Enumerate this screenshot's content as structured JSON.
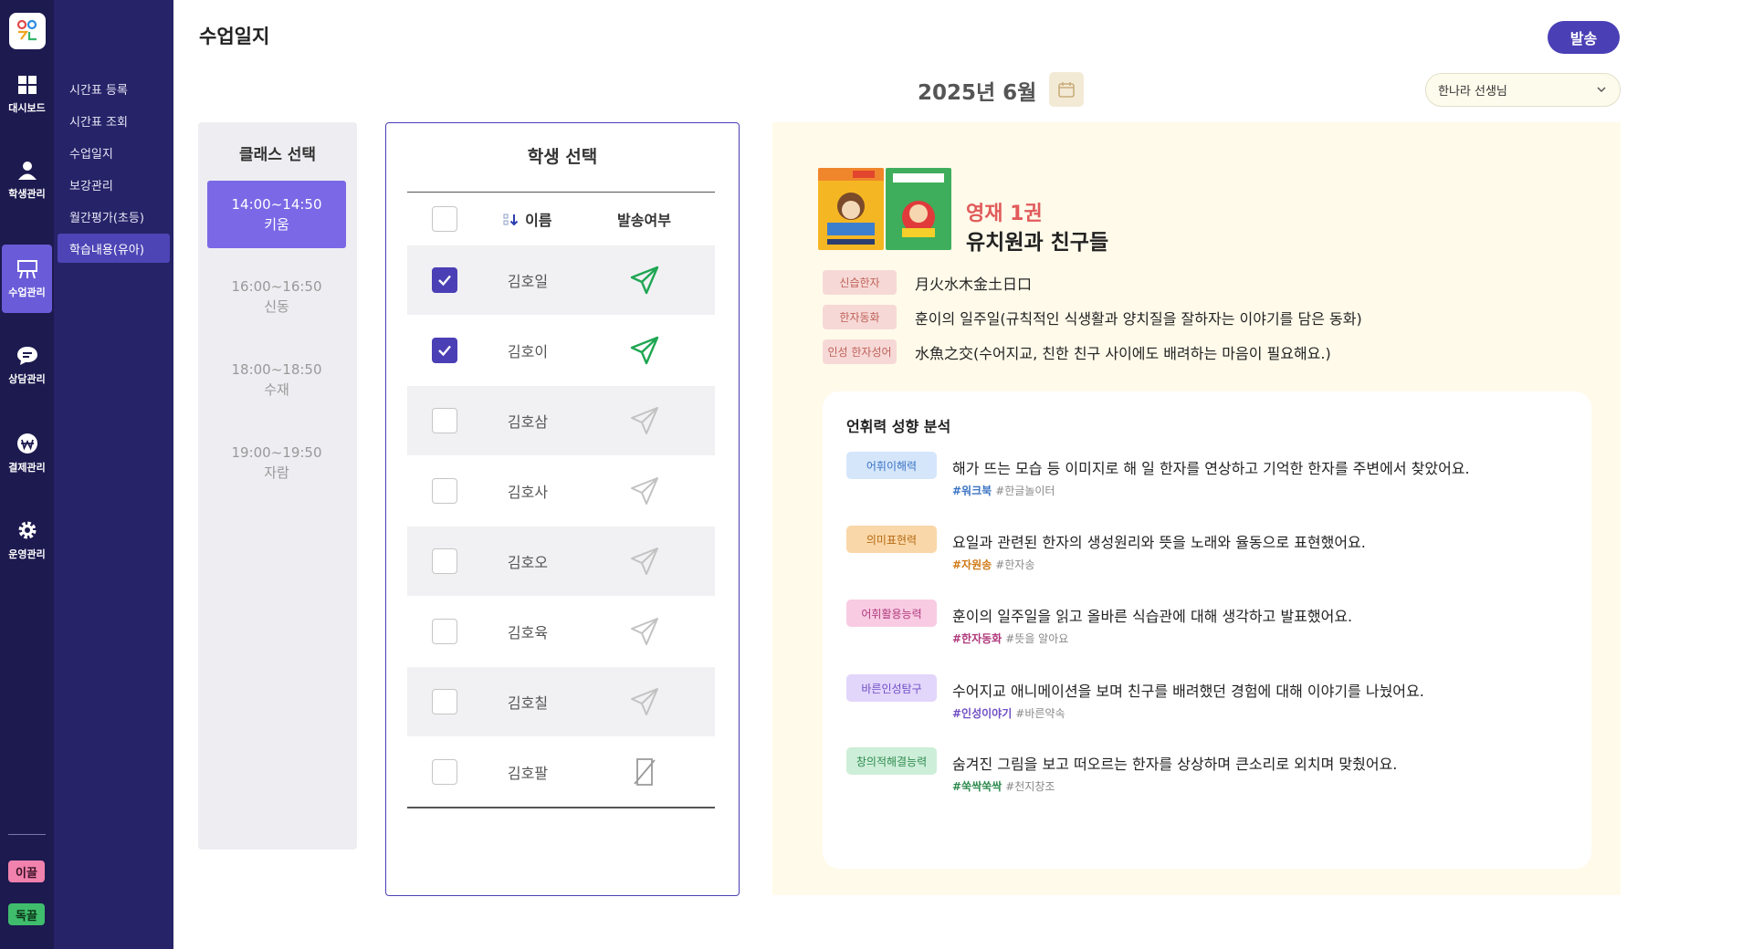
{
  "sidebar": {
    "items": [
      {
        "label": "대시보드",
        "icon": "dashboard-grid-icon"
      },
      {
        "label": "학생관리",
        "icon": "student-icon"
      },
      {
        "label": "수업관리",
        "icon": "classroom-easel-icon"
      },
      {
        "label": "상담관리",
        "icon": "chat-bubble-icon"
      },
      {
        "label": "결제관리",
        "icon": "won-coin-icon"
      },
      {
        "label": "운영관리",
        "icon": "gear-icon"
      }
    ],
    "badges": {
      "igeul": "이끌",
      "dokgeul": "독끌"
    },
    "colors": {
      "rail": "#1c1a4f",
      "active": "#6a5cd9"
    }
  },
  "submenu": {
    "items": [
      {
        "label": "시간표 등록"
      },
      {
        "label": "시간표 조회"
      },
      {
        "label": "수업일지"
      },
      {
        "label": "보강관리"
      },
      {
        "label": "월간평가(초등)"
      },
      {
        "label": "학습내용(유아)"
      }
    ]
  },
  "header": {
    "title": "수업일지",
    "send_label": "발송",
    "month": "2025년 6월",
    "teacher": "한나라 선생님"
  },
  "class_panel": {
    "title": "클래스 선택",
    "items": [
      {
        "time": "14:00~14:50",
        "name": "키움"
      },
      {
        "time": "16:00~16:50",
        "name": "신동"
      },
      {
        "time": "18:00~18:50",
        "name": "수재"
      },
      {
        "time": "19:00~19:50",
        "name": "자람"
      }
    ]
  },
  "student_panel": {
    "title": "학생 선택",
    "headers": {
      "name": "이름",
      "sent": "발송여부"
    },
    "rows": [
      {
        "name": "김호일",
        "checked": true,
        "status": "sent"
      },
      {
        "name": "김호이",
        "checked": true,
        "status": "sent"
      },
      {
        "name": "김호삼",
        "checked": false,
        "status": "pending"
      },
      {
        "name": "김호사",
        "checked": false,
        "status": "pending"
      },
      {
        "name": "김호오",
        "checked": false,
        "status": "pending"
      },
      {
        "name": "김호육",
        "checked": false,
        "status": "pending"
      },
      {
        "name": "김호칠",
        "checked": false,
        "status": "pending"
      },
      {
        "name": "김호팔",
        "checked": false,
        "status": "disabled"
      }
    ]
  },
  "detail": {
    "volume": "영재 1권",
    "book_title": "유치원과 친구들",
    "info": [
      {
        "tag": "신습한자",
        "text": "月火水木金土日口"
      },
      {
        "tag": "한자동화",
        "text": "훈이의 일주일(규칙적인 식생활과 양치질을 잘하자는 이야기를 담은 동화)"
      },
      {
        "tag": "인성 한자성어",
        "text": "水魚之交(수어지교, 친한 친구 사이에도 배려하는 마음이 필요해요.)"
      }
    ],
    "analysis_title": "언휘력 성향 분석",
    "analysis": [
      {
        "tag": "어휘이해력",
        "text": "해가 뜨는 모습 등 이미지로 해 일 한자를 연상하고 기억한 한자를 주변에서 찾았어요.",
        "tags": [
          "#워크북",
          "#한글놀이터"
        ],
        "tag_bg": "#d5e6fb",
        "tag_fg": "#3a73c4",
        "hl": "#3a73c4"
      },
      {
        "tag": "의미표현력",
        "text": "요일과 관련된 한자의 생성원리와 뜻을 노래와 율동으로 표현했어요.",
        "tags": [
          "#자원송",
          "#한자송"
        ],
        "tag_bg": "#fad7a8",
        "tag_fg": "#b36a14",
        "hl": "#d07a16"
      },
      {
        "tag": "어휘활용능력",
        "text": "훈이의 일주일을 읽고 올바른 식습관에 대해 생각하고 발표했어요.",
        "tags": [
          "#한자동화",
          "#뜻을 알아요"
        ],
        "tag_bg": "#f8cbe3",
        "tag_fg": "#b03a7c",
        "hl": "#b03a7c"
      },
      {
        "tag": "바른인성탐구",
        "text": "수어지교 애니메이션을 보며 친구를 배려했던 경험에 대해 이야기를 나눴어요.",
        "tags": [
          "#인성이야기",
          "#바른약속"
        ],
        "tag_bg": "#e2d6fb",
        "tag_fg": "#6f4fc4",
        "hl": "#6f4fc4"
      },
      {
        "tag": "창의적해결능력",
        "text": "숨겨진 그림을 보고 떠오르는 한자를 상상하며 큰소리로 외치며 맞췄어요.",
        "tags": [
          "#쑥싹쑥싹",
          "#천지창조"
        ],
        "tag_bg": "#cdeed8",
        "tag_fg": "#2f8b4f",
        "hl": "#2f8b4f"
      }
    ]
  }
}
